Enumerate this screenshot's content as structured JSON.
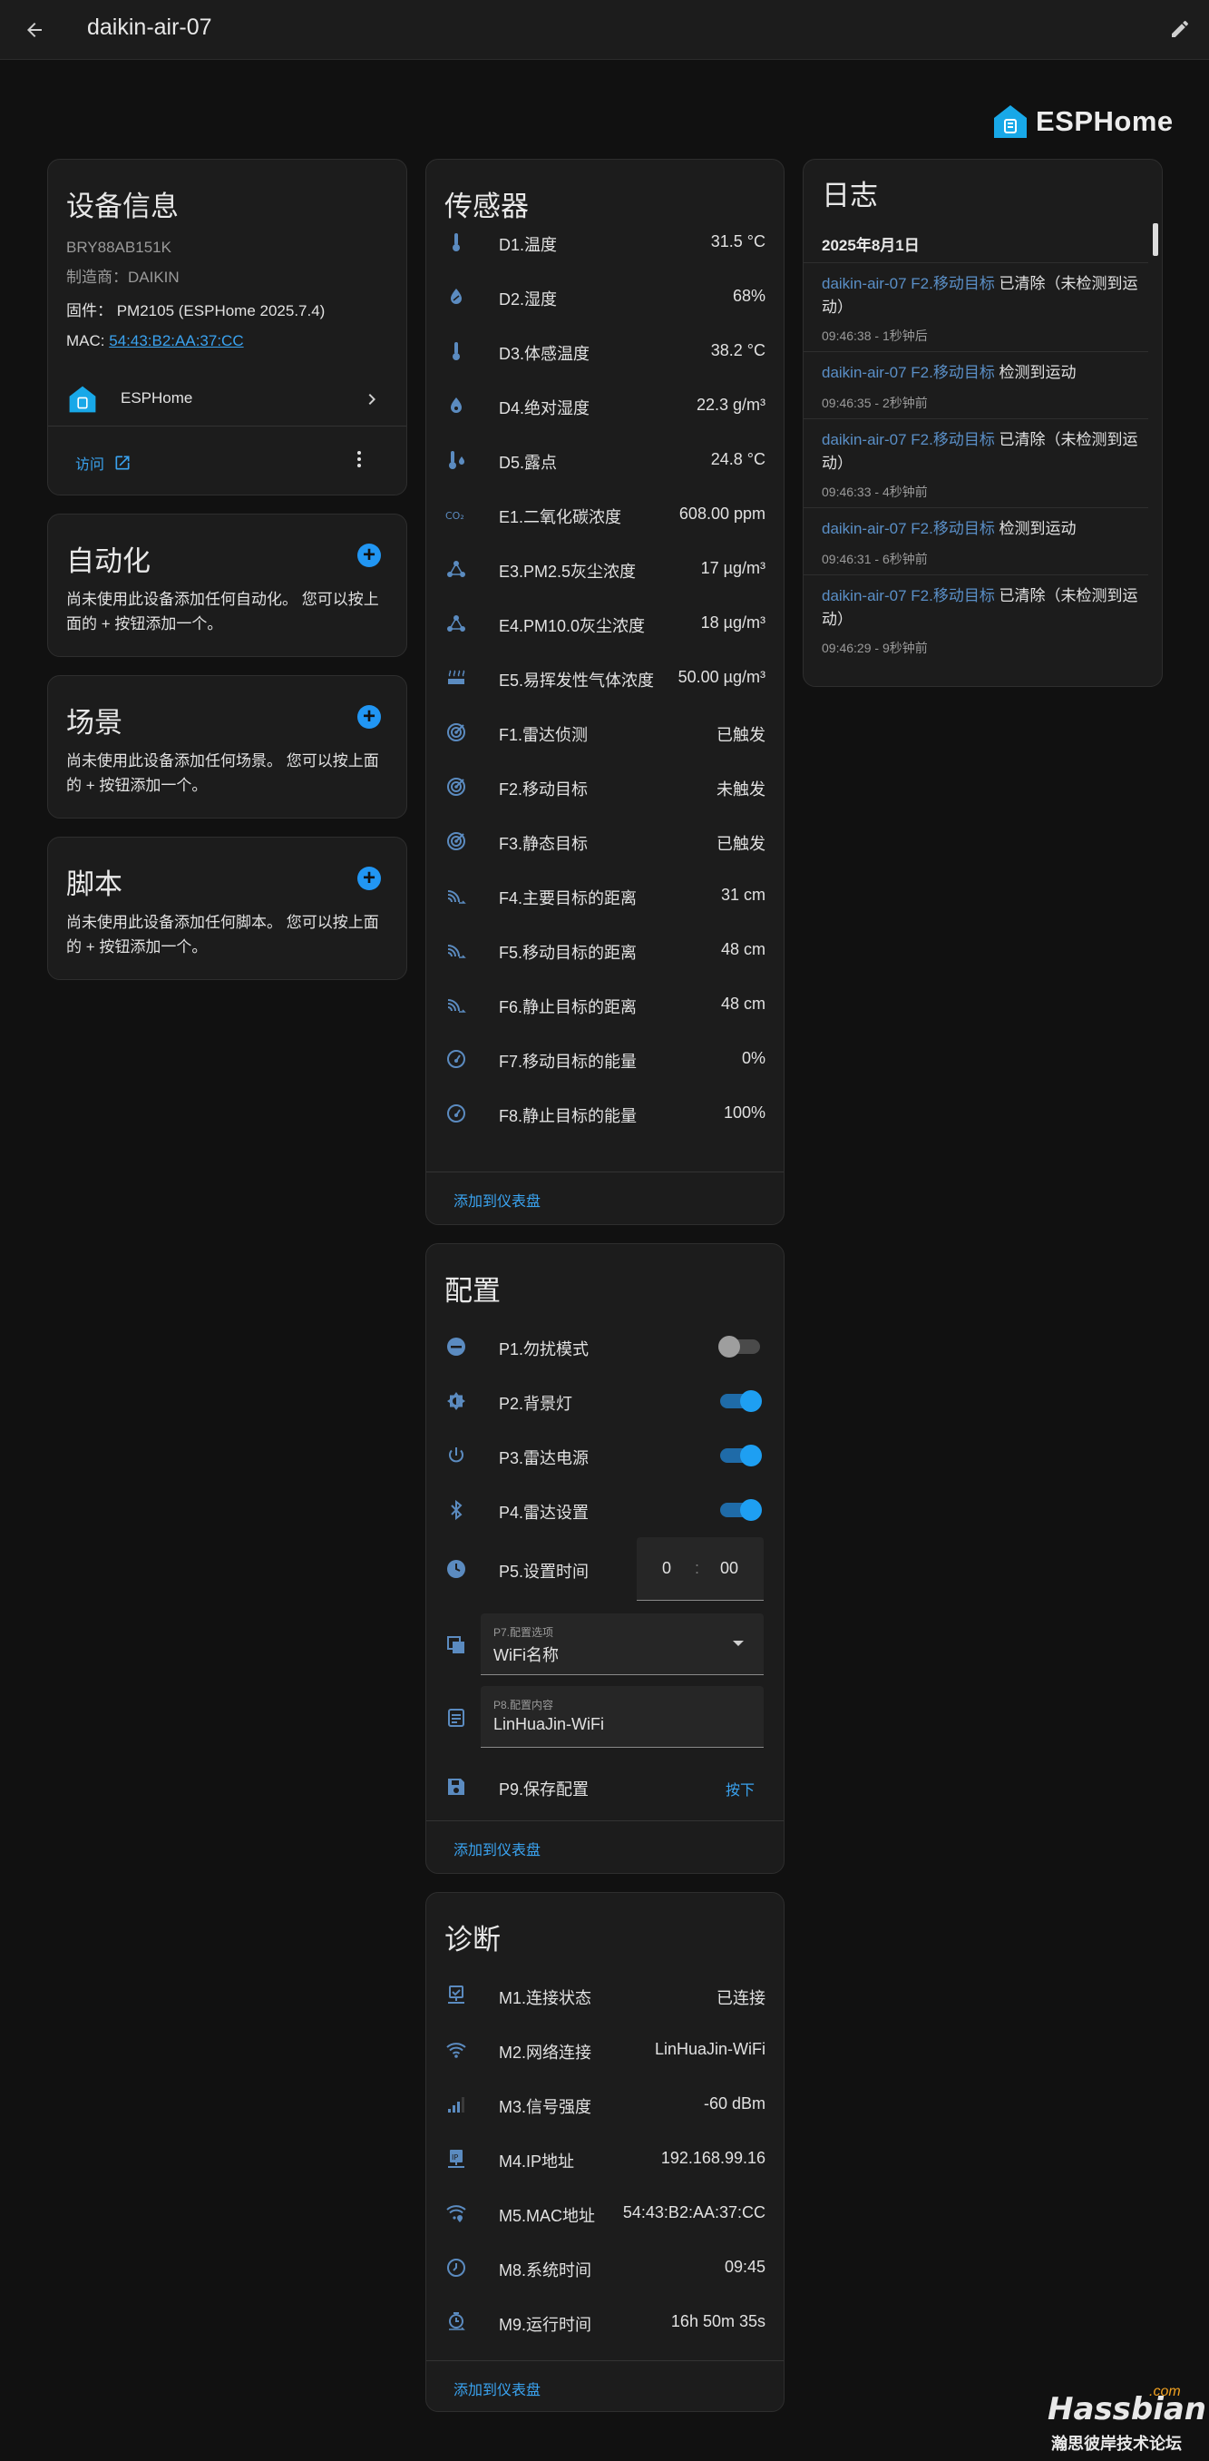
{
  "header": {
    "title": "daikin-air-07"
  },
  "brand": {
    "name": "ESPHome"
  },
  "device": {
    "title": "设备信息",
    "model": "BRY88AB151K",
    "manufacturer": "制造商：DAIKIN",
    "firmware": "固件： PM2105 (ESPHome 2025.7.4)",
    "mac_label": "MAC: ",
    "mac_value": "54:43:B2:AA:37:CC",
    "integration": "ESPHome",
    "visit": "访问"
  },
  "automation": {
    "title": "自动化",
    "text": "尚未使用此设备添加任何自动化。 您可以按上面的 + 按钮添加一个。"
  },
  "scene": {
    "title": "场景",
    "text": "尚未使用此设备添加任何场景。 您可以按上面的 + 按钮添加一个。"
  },
  "script": {
    "title": "脚本",
    "text": "尚未使用此设备添加任何脚本。 您可以按上面的 + 按钮添加一个。"
  },
  "sensors": {
    "title": "传感器",
    "footer": "添加到仪表盘",
    "rows": [
      {
        "name": "D1.温度",
        "value": "31.5 °C",
        "icon": "thermometer-icon"
      },
      {
        "name": "D2.湿度",
        "value": "68%",
        "icon": "water-percent-icon"
      },
      {
        "name": "D3.体感温度",
        "value": "38.2 °C",
        "icon": "thermometer-icon"
      },
      {
        "name": "D4.绝对湿度",
        "value": "22.3 g/m³",
        "icon": "water-icon"
      },
      {
        "name": "D5.露点",
        "value": "24.8 °C",
        "icon": "thermometer-water-icon"
      },
      {
        "name": "E1.二氧化碳浓度",
        "value": "608.00 ppm",
        "icon": "co2-icon"
      },
      {
        "name": "E3.PM2.5灰尘浓度",
        "value": "17 µg/m³",
        "icon": "molecule-icon"
      },
      {
        "name": "E4.PM10.0灰尘浓度",
        "value": "18 µg/m³",
        "icon": "molecule-icon"
      },
      {
        "name": "E5.易挥发性气体浓度",
        "value": "50.00 µg/m³",
        "icon": "heat-wave-icon"
      },
      {
        "name": "F1.雷达侦测",
        "value": "已触发",
        "icon": "radar-icon"
      },
      {
        "name": "F2.移动目标",
        "value": "未触发",
        "icon": "radar-icon"
      },
      {
        "name": "F3.静态目标",
        "value": "已触发",
        "icon": "radar-icon"
      },
      {
        "name": "F4.主要目标的距离",
        "value": "31 cm",
        "icon": "signal-distance-icon"
      },
      {
        "name": "F5.移动目标的距离",
        "value": "48 cm",
        "icon": "signal-distance-icon"
      },
      {
        "name": "F6.静止目标的距离",
        "value": "48 cm",
        "icon": "signal-distance-icon"
      },
      {
        "name": "F7.移动目标的能量",
        "value": "0%",
        "icon": "gauge-icon"
      },
      {
        "name": "F8.静止目标的能量",
        "value": "100%",
        "icon": "gauge-icon"
      }
    ]
  },
  "config": {
    "title": "配置",
    "footer": "添加到仪表盘",
    "p1": {
      "name": "P1.勿扰模式",
      "on": false,
      "icon": "minus-circle-icon"
    },
    "p2": {
      "name": "P2.背景灯",
      "on": true,
      "icon": "brightness-icon"
    },
    "p3": {
      "name": "P3.雷达电源",
      "on": true,
      "icon": "power-icon"
    },
    "p4": {
      "name": "P4.雷达设置",
      "on": true,
      "icon": "bluetooth-icon"
    },
    "p5": {
      "name": "P5.设置时间",
      "hour": "0",
      "sep": ":",
      "minute": "00",
      "icon": "clock-icon"
    },
    "p7": {
      "label": "P7.配置选项",
      "value": "WiFi名称",
      "icon": "select-icon"
    },
    "p8": {
      "label": "P8.配置内容",
      "value": "LinHuaJin-WiFi",
      "icon": "form-textbox-icon"
    },
    "p9": {
      "name": "P9.保存配置",
      "button": "按下",
      "icon": "content-save-icon"
    }
  },
  "diag": {
    "title": "诊断",
    "footer": "添加到仪表盘",
    "rows": [
      {
        "name": "M1.连接状态",
        "value": "已连接",
        "icon": "lan-check-icon"
      },
      {
        "name": "M2.网络连接",
        "value": "LinHuaJin-WiFi",
        "icon": "wifi-icon"
      },
      {
        "name": "M3.信号强度",
        "value": "-60 dBm",
        "icon": "signal-icon"
      },
      {
        "name": "M4.IP地址",
        "value": "192.168.99.16",
        "icon": "ip-network-icon"
      },
      {
        "name": "M5.MAC地址",
        "value": "54:43:B2:AA:37:CC",
        "icon": "wifi-marker-icon"
      },
      {
        "name": "M8.系统时间",
        "value": "09:45",
        "icon": "clock-outline-icon"
      },
      {
        "name": "M9.运行时间",
        "value": "16h 50m 35s",
        "icon": "timer-icon"
      }
    ]
  },
  "log": {
    "title": "日志",
    "date": "2025年8月1日",
    "entries": [
      {
        "entity": "daikin-air-07 F2.移动目标",
        "action": " 已清除（未检测到运动）",
        "time": "09:46:38 - 1秒钟后"
      },
      {
        "entity": "daikin-air-07 F2.移动目标",
        "action": " 检测到运动",
        "time": "09:46:35 - 2秒钟前"
      },
      {
        "entity": "daikin-air-07 F2.移动目标",
        "action": " 已清除（未检测到运动）",
        "time": "09:46:33 - 4秒钟前"
      },
      {
        "entity": "daikin-air-07 F2.移动目标",
        "action": " 检测到运动",
        "time": "09:46:31 - 6秒钟前"
      },
      {
        "entity": "daikin-air-07 F2.移动目标",
        "action": " 已清除（未检测到运动）",
        "time": "09:46:29 - 9秒钟前"
      }
    ]
  },
  "watermark": {
    "main": "Hassbian",
    "suffix": ".com",
    "sub": "瀚思彼岸技术论坛"
  },
  "colors": {
    "accent": "#2196f3",
    "link": "#3aa3f0",
    "icon": "#5b8bc0",
    "background": "#111111",
    "card": "#1c1c1c"
  }
}
